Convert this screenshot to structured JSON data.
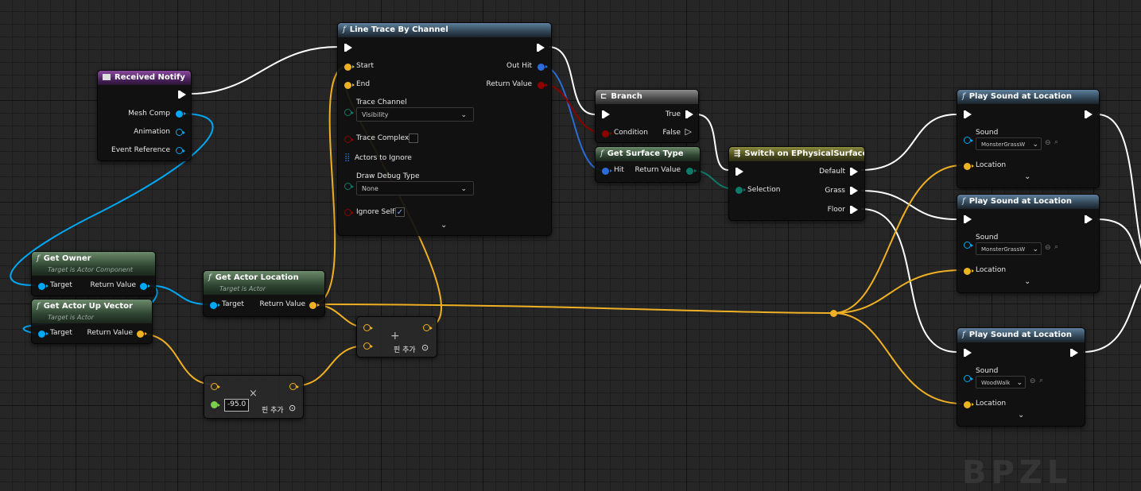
{
  "colors": {
    "exec": "#ffffff",
    "object": "#00a8f4",
    "vector": "#f0b024",
    "float": "#7ad04a",
    "enum": "#0e7a6a",
    "bool": "#8c0000",
    "struct": "#2b6dd6"
  },
  "nodes": {
    "received_notify": {
      "title": "Received Notify",
      "pins": [
        "Mesh Comp",
        "Animation",
        "Event Reference"
      ]
    },
    "get_owner": {
      "title": "Get Owner",
      "subtitle": "Target is Actor Component",
      "in": "Target",
      "out": "Return Value"
    },
    "get_actor_up_vector": {
      "title": "Get Actor Up Vector",
      "subtitle": "Target is Actor",
      "in": "Target",
      "out": "Return Value"
    },
    "get_actor_location": {
      "title": "Get Actor Location",
      "subtitle": "Target is Actor",
      "in": "Target",
      "out": "Return Value"
    },
    "line_trace": {
      "title": "Line Trace By Channel",
      "start": "Start",
      "end": "End",
      "trace_channel": "Trace Channel",
      "trace_channel_value": "Visibility",
      "trace_complex": "Trace Complex",
      "actors_to_ignore": "Actors to Ignore",
      "draw_debug_type": "Draw Debug Type",
      "draw_debug_value": "None",
      "ignore_self": "Ignore Self",
      "out_hit": "Out Hit",
      "return_value": "Return Value"
    },
    "branch": {
      "title": "Branch",
      "condition": "Condition",
      "true": "True",
      "false": "False"
    },
    "get_surface_type": {
      "title": "Get Surface Type",
      "hit": "Hit",
      "return_value": "Return Value"
    },
    "switch": {
      "title": "Switch on EPhysicalSurface",
      "selection": "Selection",
      "outs": [
        "Default",
        "Grass",
        "Floor"
      ]
    },
    "multiply": {
      "value": "-95.0",
      "add_pin": "핀 추가"
    },
    "add": {
      "add_pin": "핀 추가"
    },
    "play_sound_1": {
      "title": "Play Sound at Location",
      "sound": "Sound",
      "sound_value": "MonsterGrassW",
      "location": "Location"
    },
    "play_sound_2": {
      "title": "Play Sound at Location",
      "sound": "Sound",
      "sound_value": "MonsterGrassW",
      "location": "Location"
    },
    "play_sound_3": {
      "title": "Play Sound at Location",
      "sound": "Sound",
      "sound_value": "WoodWalk",
      "location": "Location"
    }
  },
  "watermark": "BPZL"
}
